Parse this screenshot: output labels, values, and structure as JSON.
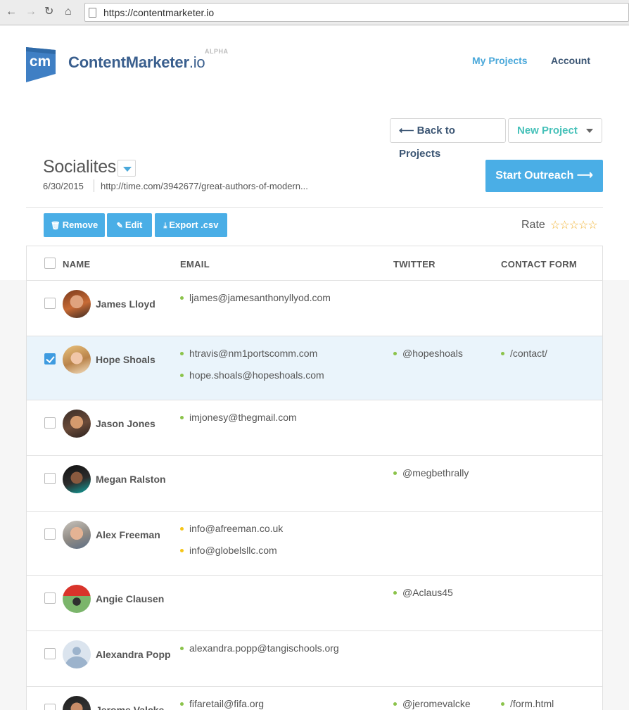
{
  "browser": {
    "url": "https://contentmarketer.io"
  },
  "header": {
    "logo_mark": "cm",
    "brand_bold": "ContentMarketer",
    "brand_light": ".io",
    "badge": "ALPHA",
    "nav": [
      "My Projects",
      "Account"
    ]
  },
  "toolbar": {
    "back_label": "⟵ Back to Projects",
    "new_label": "New Project"
  },
  "project": {
    "title": "Socialites",
    "date": "6/30/2015",
    "url": "http://time.com/3942677/great-authors-of-modern...",
    "outreach_label": "Start Outreach ⟶"
  },
  "actions": {
    "remove": "Remove",
    "edit": "Edit",
    "export": "Export .csv",
    "rate_label": "Rate",
    "stars": "☆☆☆☆☆"
  },
  "colors": {
    "accent_blue": "#4aaee6",
    "teal": "#46c1b9",
    "status_green": "#8bc34a",
    "status_yellow": "#f5c518"
  },
  "table": {
    "headers": [
      "NAME",
      "EMAIL",
      "TWITTER",
      "CONTACT FORM"
    ],
    "rows": [
      {
        "name": "James Lloyd",
        "selected": false,
        "emails": [
          {
            "text": "ljames@jamesanthonyllyod.com",
            "status": "green"
          }
        ],
        "twitter": [],
        "contact": []
      },
      {
        "name": "Hope Shoals",
        "selected": true,
        "emails": [
          {
            "text": "htravis@nm1portscomm.com",
            "status": "green"
          },
          {
            "text": "hope.shoals@hopeshoals.com",
            "status": "green"
          }
        ],
        "twitter": [
          {
            "text": "@hopeshoals",
            "status": "green"
          }
        ],
        "contact": [
          {
            "text": "/contact/",
            "status": "green"
          }
        ]
      },
      {
        "name": "Jason Jones",
        "selected": false,
        "emails": [
          {
            "text": "imjonesy@thegmail.com",
            "status": "green"
          }
        ],
        "twitter": [],
        "contact": []
      },
      {
        "name": "Megan Ralston",
        "selected": false,
        "emails": [],
        "twitter": [
          {
            "text": "@megbethrally",
            "status": "green"
          }
        ],
        "contact": []
      },
      {
        "name": "Alex Freeman",
        "selected": false,
        "emails": [
          {
            "text": "info@afreeman.co.uk",
            "status": "yellow"
          },
          {
            "text": "info@globelsllc.com",
            "status": "yellow"
          }
        ],
        "twitter": [],
        "contact": []
      },
      {
        "name": "Angie Clausen",
        "selected": false,
        "emails": [],
        "twitter": [
          {
            "text": "@Aclaus45",
            "status": "green"
          }
        ],
        "contact": []
      },
      {
        "name": "Alexandra Popp",
        "selected": false,
        "emails": [
          {
            "text": "alexandra.popp@tangischools.org",
            "status": "green"
          }
        ],
        "twitter": [],
        "contact": []
      },
      {
        "name": "Jerome Valcke",
        "selected": false,
        "emails": [
          {
            "text": "fifaretail@fifa.org",
            "status": "green"
          }
        ],
        "twitter": [
          {
            "text": "@jeromevalcke",
            "status": "green"
          }
        ],
        "contact": [
          {
            "text": "/form.html",
            "status": "green"
          }
        ]
      }
    ]
  }
}
